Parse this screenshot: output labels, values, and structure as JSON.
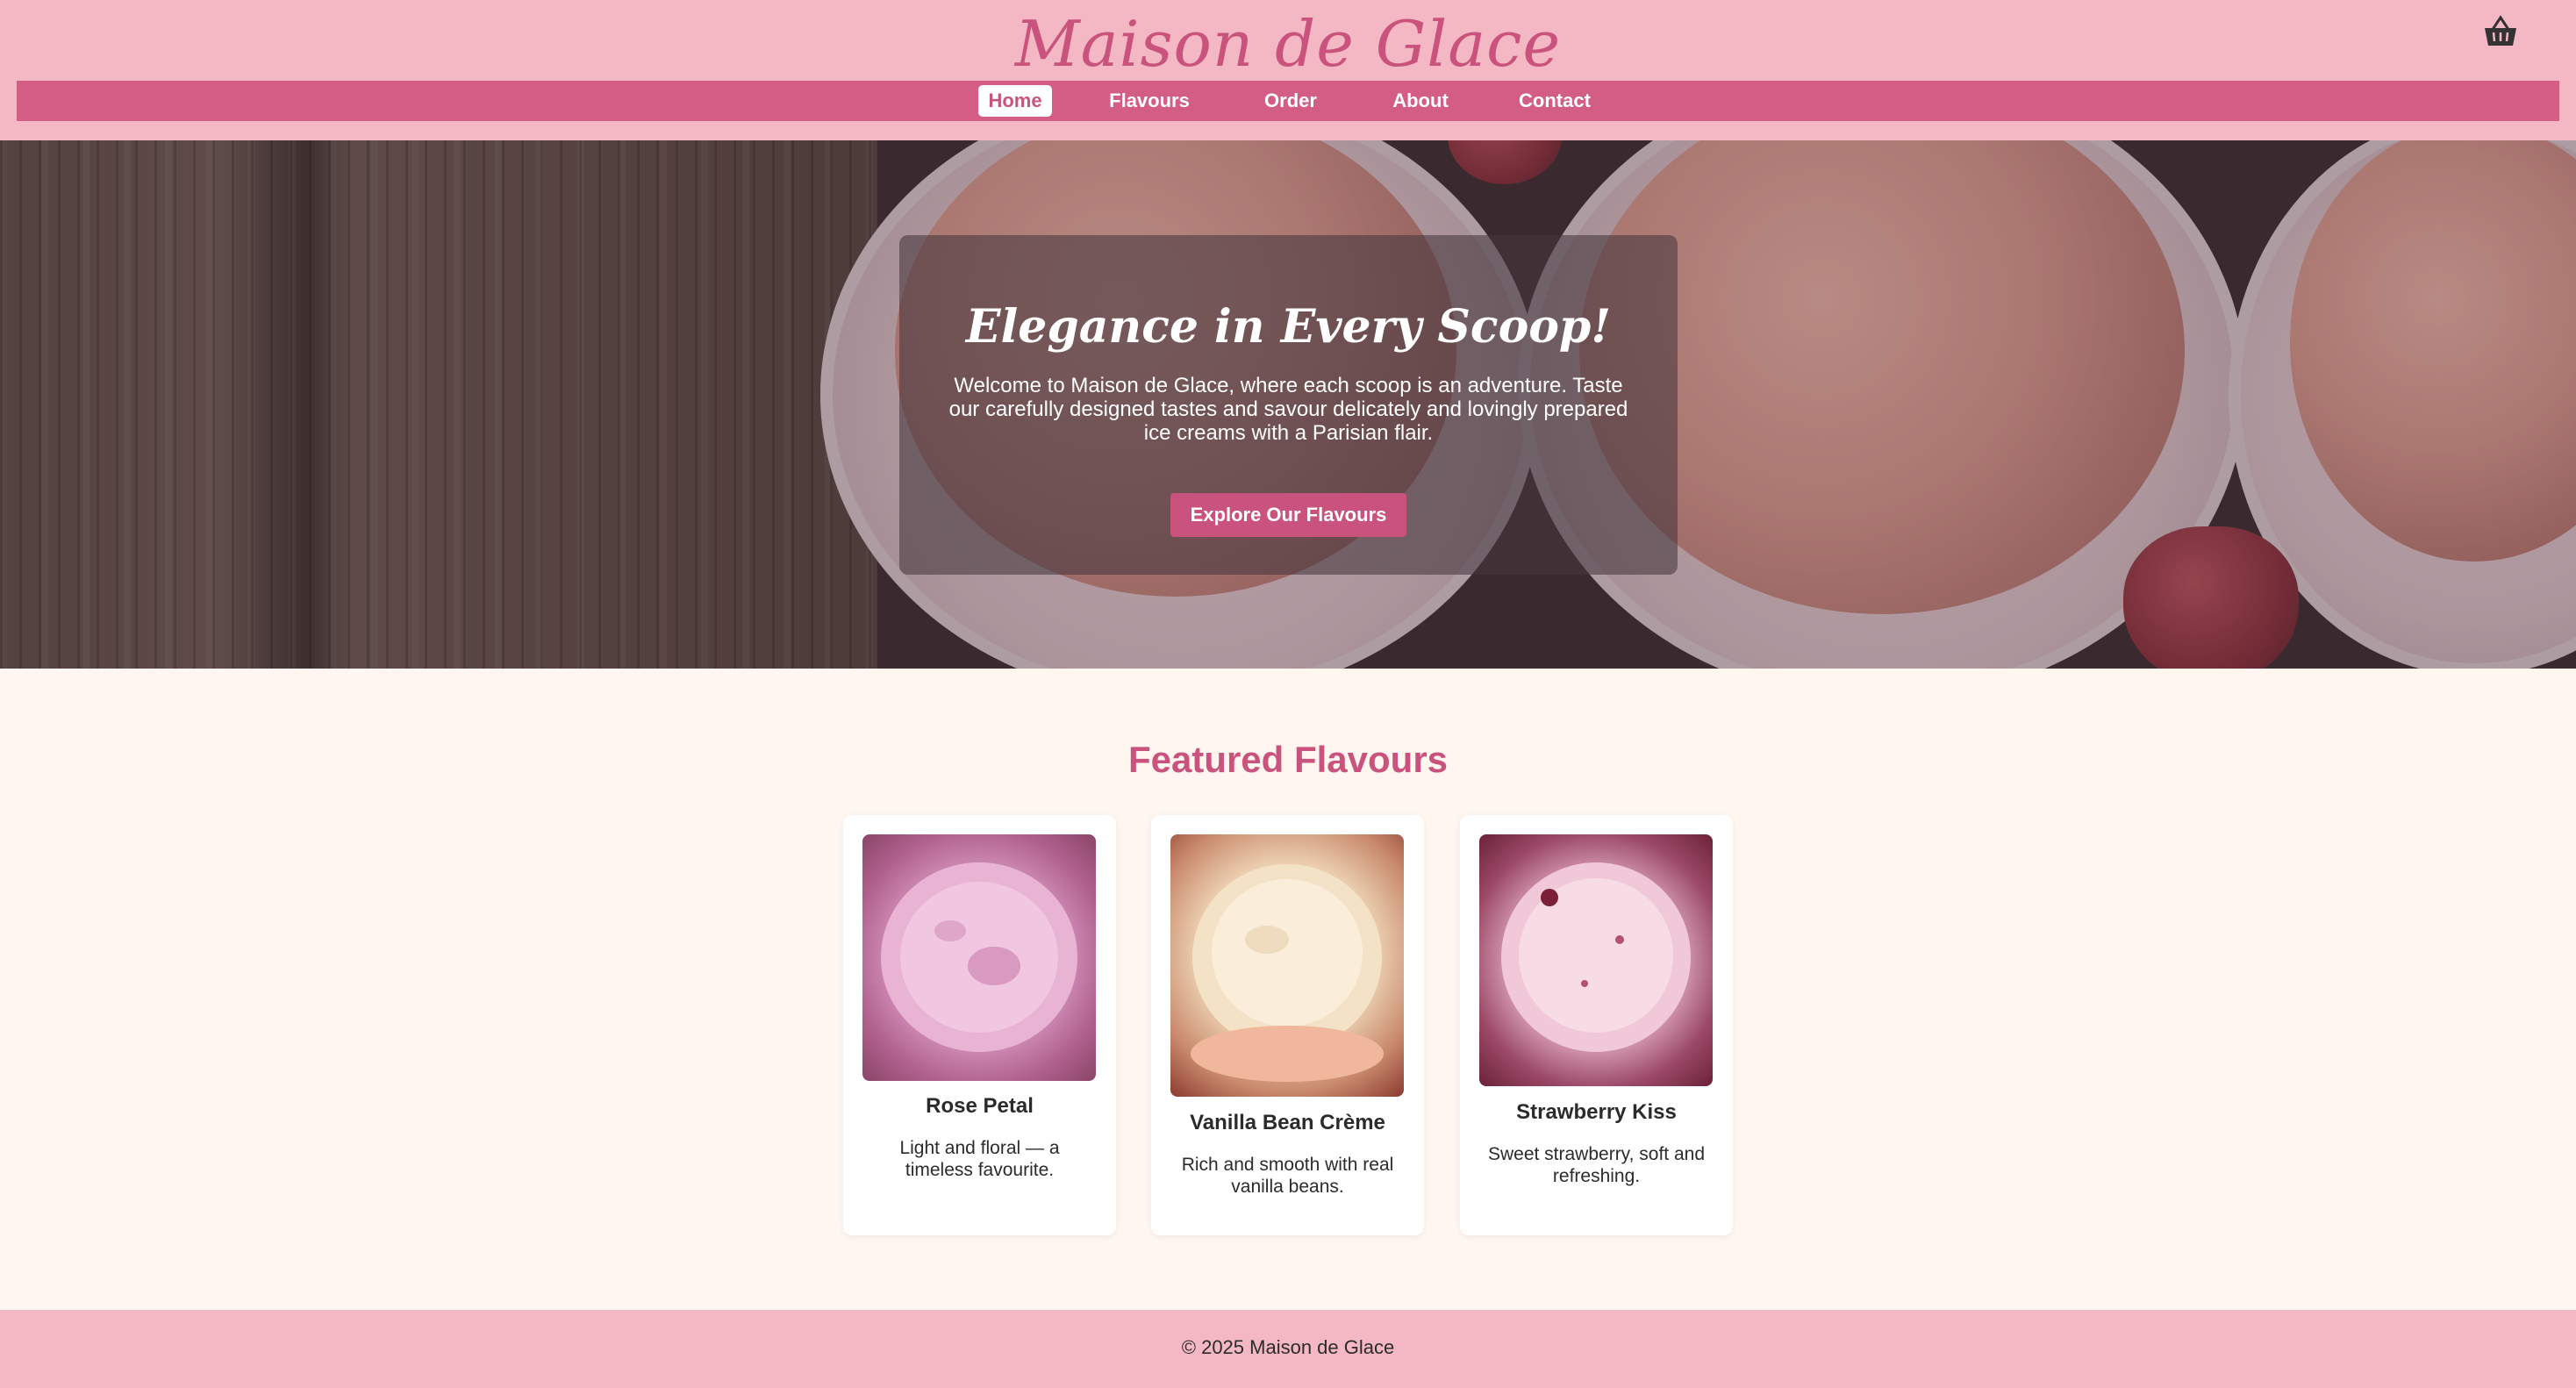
{
  "header": {
    "brand": "Maison de Glace",
    "cart_icon": "basket-icon",
    "nav": [
      {
        "label": "Home",
        "active": true
      },
      {
        "label": "Flavours",
        "active": false
      },
      {
        "label": "Order",
        "active": false
      },
      {
        "label": "About",
        "active": false
      },
      {
        "label": "Contact",
        "active": false
      }
    ]
  },
  "hero": {
    "title": "Elegance in Every Scoop!",
    "text": "Welcome to Maison de Glace, where each scoop is an adventure. Taste our carefully designed tastes and savour delicately and lovingly prepared ice creams with a Parisian flair.",
    "button_label": "Explore Our Flavours"
  },
  "featured": {
    "title": "Featured Flavours",
    "items": [
      {
        "name": "Rose Petal",
        "description": "Light and floral — a timeless favourite.",
        "image": "rose-petal-ice-cream-photo"
      },
      {
        "name": "Vanilla Bean Crème",
        "description": "Rich and smooth with real vanilla beans.",
        "image": "vanilla-bean-ice-cream-photo"
      },
      {
        "name": "Strawberry Kiss",
        "description": "Sweet strawberry, soft and refreshing.",
        "image": "strawberry-ice-cream-photo"
      }
    ]
  },
  "footer": {
    "text": "© 2025 Maison de Glace"
  },
  "colors": {
    "header_bg": "#f4b8c4",
    "nav_bg": "#d35d84",
    "accent": "#c9537c",
    "page_bg": "#fff6f0"
  }
}
